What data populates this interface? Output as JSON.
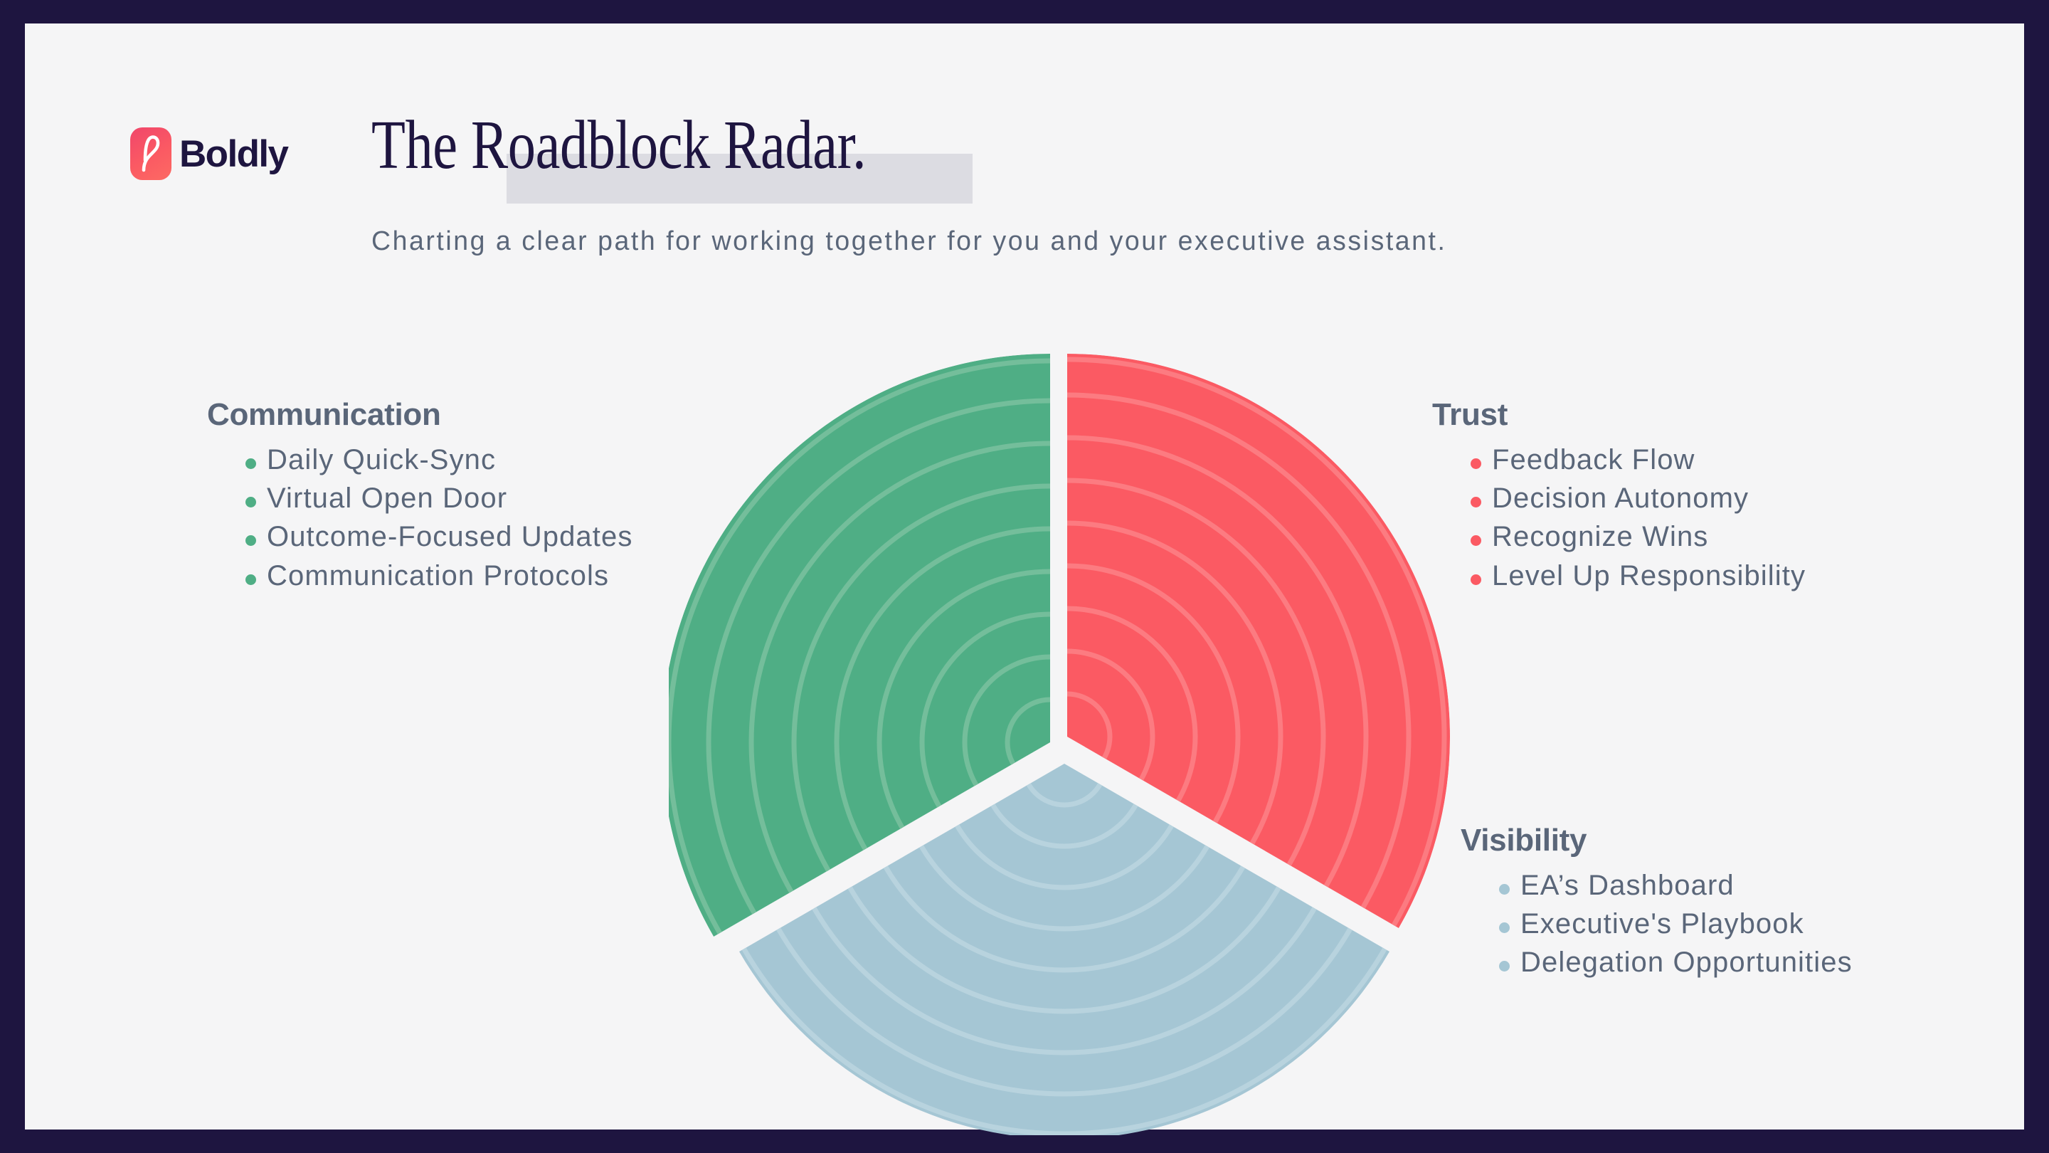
{
  "brand": {
    "logo_icon": "boldly-logo-mark",
    "name": "Boldly"
  },
  "header": {
    "title": "The Roadblock Radar.",
    "subtitle": "Charting a clear path for working together for you and your executive assistant."
  },
  "colors": {
    "frame": "#1E1540",
    "panel": "#F5F5F6",
    "title_text": "#1E1540",
    "title_highlight": "#DCDCE2",
    "body_text": "#5A6679",
    "communication": "#4FAE85",
    "trust": "#FB5A63",
    "visibility": "#A5C6D4"
  },
  "columns": {
    "communication": {
      "heading": "Communication",
      "color": "#4FAE85",
      "items": [
        "Daily Quick-Sync",
        "Virtual Open Door",
        "Outcome-Focused Updates",
        "Communication Protocols"
      ]
    },
    "trust": {
      "heading": "Trust",
      "color": "#FB5A63",
      "items": [
        "Feedback Flow",
        "Decision Autonomy",
        "Recognize Wins",
        "Level Up Responsibility"
      ]
    },
    "visibility": {
      "heading": "Visibility",
      "color": "#A5C6D4",
      "items": [
        "EA’s Dashboard",
        "Executive's Playbook",
        "Delegation Opportunities"
      ]
    }
  },
  "chart_data": {
    "type": "pie",
    "title": "The Roadblock Radar.",
    "subtitle": "Charting a clear path for working together for you and your executive assistant.",
    "note": "Three-sector radar/pie with concentric rings; each sector is one-third (120 degrees) of the circle, separated by white radial gaps.",
    "legend_position": "sides",
    "grid": true,
    "ring_count": 9,
    "categories": [
      "Communication",
      "Trust",
      "Visibility"
    ],
    "values": [
      33.3,
      33.3,
      33.3
    ],
    "series": [
      {
        "name": "Communication",
        "color": "#4FAE85",
        "start_angle_deg": 240,
        "end_angle_deg": 360,
        "radius": 540,
        "items": [
          "Daily Quick-Sync",
          "Virtual Open Door",
          "Outcome-Focused Updates",
          "Communication Protocols"
        ]
      },
      {
        "name": "Trust",
        "color": "#FB5A63",
        "start_angle_deg": 0,
        "end_angle_deg": 120,
        "radius": 540,
        "items": [
          "Feedback Flow",
          "Decision Autonomy",
          "Recognize Wins",
          "Level Up Responsibility"
        ]
      },
      {
        "name": "Visibility",
        "color": "#A5C6D4",
        "start_angle_deg": 120,
        "end_angle_deg": 240,
        "radius": 505,
        "items": [
          "EA’s Dashboard",
          "Executive's Playbook",
          "Delegation Opportunities"
        ]
      }
    ]
  }
}
